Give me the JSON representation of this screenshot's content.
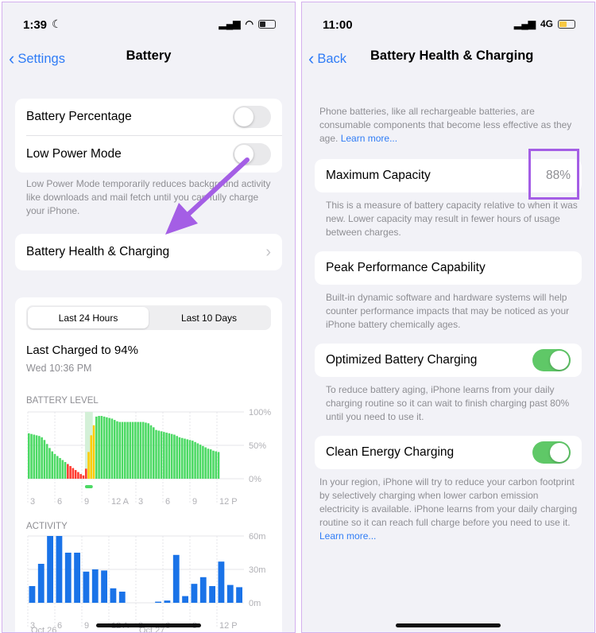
{
  "left": {
    "status": {
      "time": "1:39",
      "icons": [
        "moon-icon",
        "signal-icon",
        "wifi-icon",
        "battery-icon"
      ]
    },
    "nav": {
      "back": "Settings",
      "title": "Battery"
    },
    "toggles": [
      {
        "label": "Battery Percentage",
        "on": false
      },
      {
        "label": "Low Power Mode",
        "on": false
      }
    ],
    "low_power_note": "Low Power Mode temporarily reduces background activity like downloads and mail fetch until you can fully charge your iPhone.",
    "health_row": "Battery Health & Charging",
    "segments": [
      "Last 24 Hours",
      "Last 10 Days"
    ],
    "selected_segment": "Last 24 Hours",
    "last_charged": "Last Charged to 94%",
    "last_charged_time": "Wed 10:36 PM",
    "battery_chart": {
      "title": "BATTERY LEVEL",
      "y_ticks": [
        "100%",
        "50%",
        "0%"
      ],
      "x_ticks": [
        "3",
        "6",
        "9",
        "12 A",
        "3",
        "6",
        "9",
        "12 P"
      ],
      "levels": [
        68,
        67,
        66,
        65,
        64,
        62,
        58,
        52,
        46,
        41,
        37,
        34,
        31,
        28,
        25,
        22,
        19,
        16,
        13,
        10,
        7,
        5,
        15,
        40,
        65,
        80,
        93,
        94,
        94,
        93,
        92,
        91,
        90,
        88,
        86,
        85,
        85,
        85,
        85,
        85,
        85,
        85,
        85,
        85,
        85,
        84,
        83,
        80,
        77,
        73,
        72,
        71,
        70,
        69,
        68,
        67,
        66,
        64,
        62,
        61,
        60,
        59,
        58,
        57,
        55,
        53,
        51,
        49,
        47,
        45,
        44,
        42,
        41,
        40
      ],
      "colors": {
        "normal": "#4cd964",
        "low": "#ff3b30",
        "charging": "#ffcc00",
        "charge_band": "#d4f0d8"
      }
    },
    "activity_chart": {
      "title": "ACTIVITY",
      "y_ticks": [
        "60m",
        "30m",
        "0m"
      ],
      "x_ticks": [
        "3",
        "6",
        "9",
        "12 A",
        "3",
        "6",
        "9",
        "12 P"
      ],
      "dates": [
        "Oct 26",
        "Oct 27"
      ],
      "minutes": [
        15,
        35,
        60,
        60,
        45,
        45,
        28,
        30,
        29,
        13,
        10,
        0,
        0,
        0,
        1,
        2,
        43,
        6,
        17,
        23,
        15,
        37,
        16,
        14
      ],
      "color": "#1a73e8"
    }
  },
  "right": {
    "status": {
      "time": "11:00",
      "network": "4G",
      "icons": [
        "signal-icon",
        "battery-icon"
      ]
    },
    "nav": {
      "back": "Back",
      "title": "Battery Health & Charging"
    },
    "intro": "Phone batteries, like all rechargeable batteries, are consumable components that become less effective as they age.",
    "learn_more": "Learn more...",
    "max_capacity": {
      "label": "Maximum Capacity",
      "value": "88%",
      "note": "This is a measure of battery capacity relative to when it was new. Lower capacity may result in fewer hours of usage between charges."
    },
    "peak": {
      "label": "Peak Performance Capability",
      "note": "Built-in dynamic software and hardware systems will help counter performance impacts that may be noticed as your iPhone battery chemically ages."
    },
    "optimized": {
      "label": "Optimized Battery Charging",
      "on": true,
      "note": "To reduce battery aging, iPhone learns from your daily charging routine so it can wait to finish charging past 80% until you need to use it."
    },
    "clean": {
      "label": "Clean Energy Charging",
      "on": true,
      "note": "In your region, iPhone will try to reduce your carbon footprint by selectively charging when lower carbon emission electricity is available. iPhone learns from your daily charging routine so it can reach full charge before you need to use it.",
      "learn_more": "Learn more..."
    }
  },
  "colors": {
    "accent": "#2f7cf6",
    "highlight": "#a45ee5",
    "toggle_on": "#5fc867"
  }
}
